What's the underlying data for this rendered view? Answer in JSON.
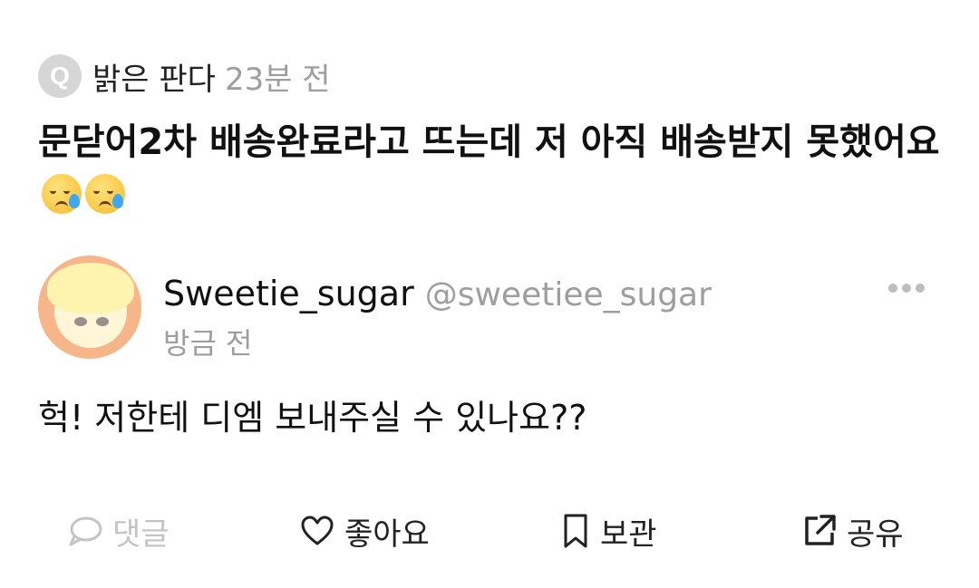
{
  "question": {
    "badge": "Q",
    "author": "밝은 판다",
    "time": "23분 전",
    "text": "문닫어2차 배송완료라고 뜨는데 저 아직 배송받지 못했어요",
    "emoji": [
      "crying-smile-emoji",
      "crying-smile-emoji"
    ]
  },
  "reply": {
    "display_name": "Sweetie_sugar",
    "handle": "@sweetiee_sugar",
    "time": "방금 전",
    "text": "헉! 저한테 디엠 보내주실 수 있나요??"
  },
  "actions": {
    "comment": "댓글",
    "like": "좋아요",
    "save": "보관",
    "share": "공유"
  },
  "colors": {
    "muted": "#9e9e9e",
    "disabled": "#c4c4c4",
    "badge_bg": "#d6d6d6"
  }
}
